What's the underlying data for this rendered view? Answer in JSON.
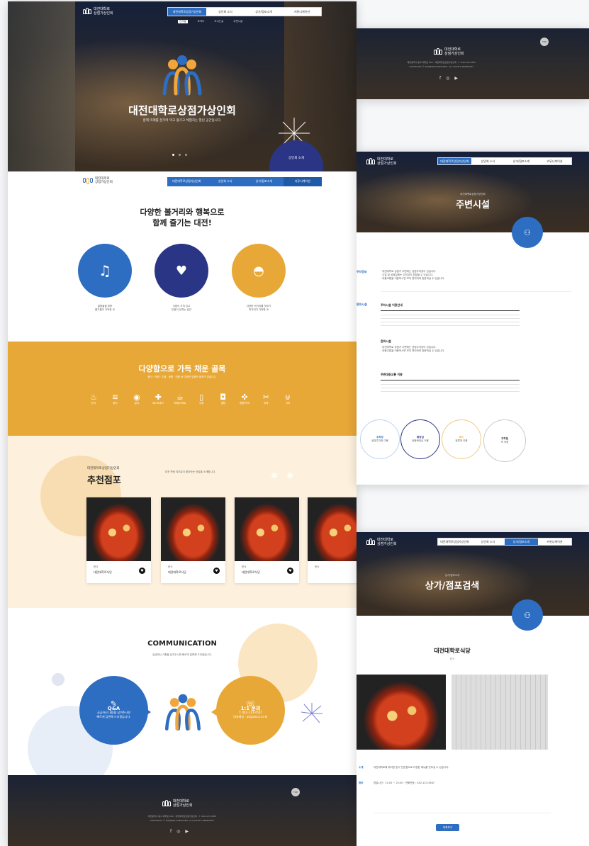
{
  "colors": {
    "blue": "#2d6ec2",
    "navy": "#2a3586",
    "orange": "#e8a838",
    "cream": "#fdf1dd"
  },
  "brand": {
    "logo_line1": "대전대학로",
    "logo_line2": "상점가상인회",
    "name": "대전대학로상점가상인회",
    "tagline": "함께 미래를 꿈꾸며 먹고 즐기고 체험하는 열린 공간입니다."
  },
  "nav": {
    "items": [
      "대전대학로상점가상인회",
      "상인회 소식",
      "상가/점포소개",
      "커뮤니케이션"
    ],
    "sub": [
      "인사말",
      "조직도",
      "오시는길",
      "주변시설"
    ]
  },
  "hero": {
    "badge": "상인회 소개"
  },
  "intro": {
    "title_line1": "다양한 볼거리와 행복으로",
    "title_line2": "함께 즐기는 대전!",
    "features": [
      {
        "icon": "guitar-icon",
        "line1": "젊음들을 위한",
        "line2": "즐거움이 가득한 곳"
      },
      {
        "icon": "heart-hands-icon",
        "line1": "사람이 가치 있고",
        "line2": "인정이 넘치는 공간"
      },
      {
        "icon": "dish-icon",
        "line1": "다양한 먹거리를 맛보기",
        "line2": "먹거리가 가득한 곳"
      }
    ]
  },
  "category": {
    "title": "다양함으로 가득 채운 골목",
    "subtitle": "음식 · 카페 · 주점 · 생활 · 미용 등 다양한 업종의 점포가 있습니다.",
    "items": [
      {
        "icon": "food-icon",
        "label": "한식"
      },
      {
        "icon": "noodle-icon",
        "label": "중식"
      },
      {
        "icon": "sushi-icon",
        "label": "일식"
      },
      {
        "icon": "steak-icon",
        "label": "패스트푸드"
      },
      {
        "icon": "coffee-icon",
        "label": "카페/디저트"
      },
      {
        "icon": "beer-icon",
        "label": "주점"
      },
      {
        "icon": "bag-icon",
        "label": "생활"
      },
      {
        "icon": "cross-icon",
        "label": "병원/약국"
      },
      {
        "icon": "scissors-icon",
        "label": "미용"
      },
      {
        "icon": "basket-icon",
        "label": "기타"
      }
    ]
  },
  "recommend": {
    "kicker": "대전대학로상점가상인회",
    "title": "추천점포",
    "desc": "대전 학생 여러분이 좋아하는 맛집을 소개합니다.",
    "cards": [
      {
        "cat": "한식",
        "name": "대전대학로식당"
      },
      {
        "cat": "한식",
        "name": "대전대학로식당"
      },
      {
        "cat": "한식",
        "name": "대전대학로식당"
      },
      {
        "cat": "한식",
        "name": ""
      }
    ]
  },
  "communication": {
    "title": "COMMUNICATION",
    "subtitle": "궁금하신 사항을 남겨주시면 빠르게 답변해 드리겠습니다.",
    "qa": {
      "title": "Q&A",
      "line1": "궁금하신 내용을 남겨주시면",
      "line2": "빠르게 답변해 드리겠습니다."
    },
    "chat": {
      "title": "1:1 문의",
      "phone": "T. 042-123-4567",
      "email": "대표메일 : ab@abcd.co.kr"
    }
  },
  "footer": {
    "address": "대전광역시 동구 대학로 000 · 대전대학로상점가상인회 · T. 042-123-4567",
    "copyright": "COPYRIGHT © DAEJEON DAEHAKRO. ALL RIGHTS RESERVED.",
    "top": "TOP"
  },
  "facility": {
    "kicker": "대전대학로상점가상인회",
    "title": "주변시설",
    "sec1": "주차정보",
    "sec2": "편의시설",
    "table_title": "주차시설 이용안내",
    "sub1": "편의시설",
    "sub2": "주변대중교통 이용",
    "bullets": [
      "· 대전대학로 상점가 주변에는 공영주차장이 있습니다.",
      "· 주말 및 공휴일에는 주차장이 혼잡할 수 있습니다.",
      "· 대중교통을 이용하시면 보다 편리하게 방문하실 수 있습니다."
    ],
    "circles": [
      {
        "title": "주차장",
        "body": "공영주차장 이용"
      },
      {
        "title": "화장실",
        "body": "공중화장실 이용"
      },
      {
        "title": "버스",
        "body": "정류장 이용"
      },
      {
        "title": "지하철",
        "body": "역 이용"
      }
    ]
  },
  "store": {
    "kicker": "상가/점포소개",
    "title": "상가/점포검색",
    "name": "대전대학로식당",
    "category": "한식",
    "info_label1": "소개",
    "info_label2": "정보",
    "info1": "대전대학로에 위치한 한식 전문점으로 다양한 메뉴를 맛보실 수 있습니다.",
    "info2": "영업시간 : 11:00 ~ 22:00 · 전화번호 : 042-123-4567",
    "button": "목록보기"
  }
}
